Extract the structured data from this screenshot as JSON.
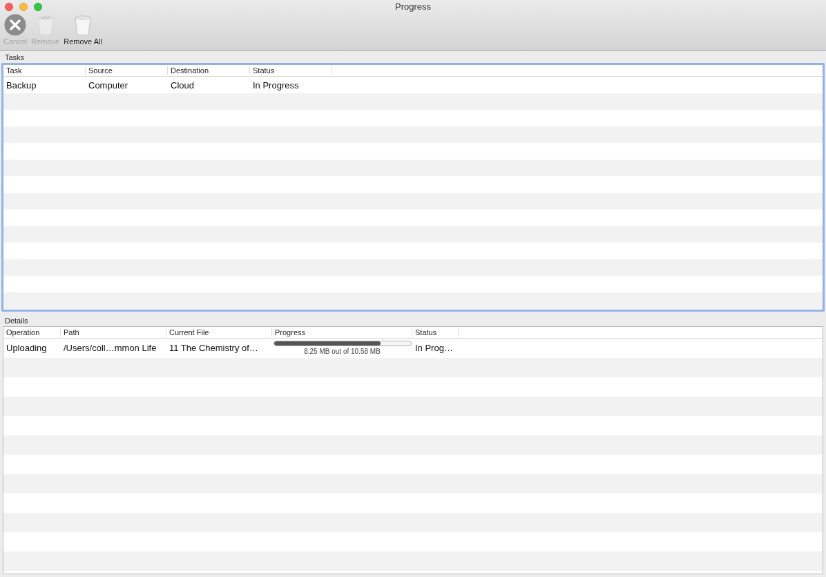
{
  "window": {
    "title": "Progress"
  },
  "toolbar": [
    {
      "kind": "x-circle",
      "label": "Cancel",
      "disabled": true
    },
    {
      "kind": "trash-full",
      "label": "Remove",
      "disabled": true
    },
    {
      "kind": "trash-empty",
      "label": "Remove All",
      "disabled": false
    }
  ],
  "tasks": {
    "label": "Tasks",
    "focused": true,
    "columns": [
      "Task",
      "Source",
      "Destination",
      "Status"
    ],
    "rows": [
      {
        "cells": [
          "Backup",
          "Computer",
          "Cloud",
          "In Progress"
        ]
      }
    ]
  },
  "details": {
    "label": "Details",
    "focused": false,
    "columns": [
      "Operation",
      "Path",
      "Current File",
      "Progress",
      "Status"
    ],
    "rows": [
      {
        "cells": [
          "Uploading",
          "/Users/coll…mmon Life",
          "11 The Chemistry of…",
          {
            "level": 0.78,
            "reading": "8.25 MB out of 10.58 MB"
          },
          "In Prog…"
        ]
      }
    ]
  }
}
